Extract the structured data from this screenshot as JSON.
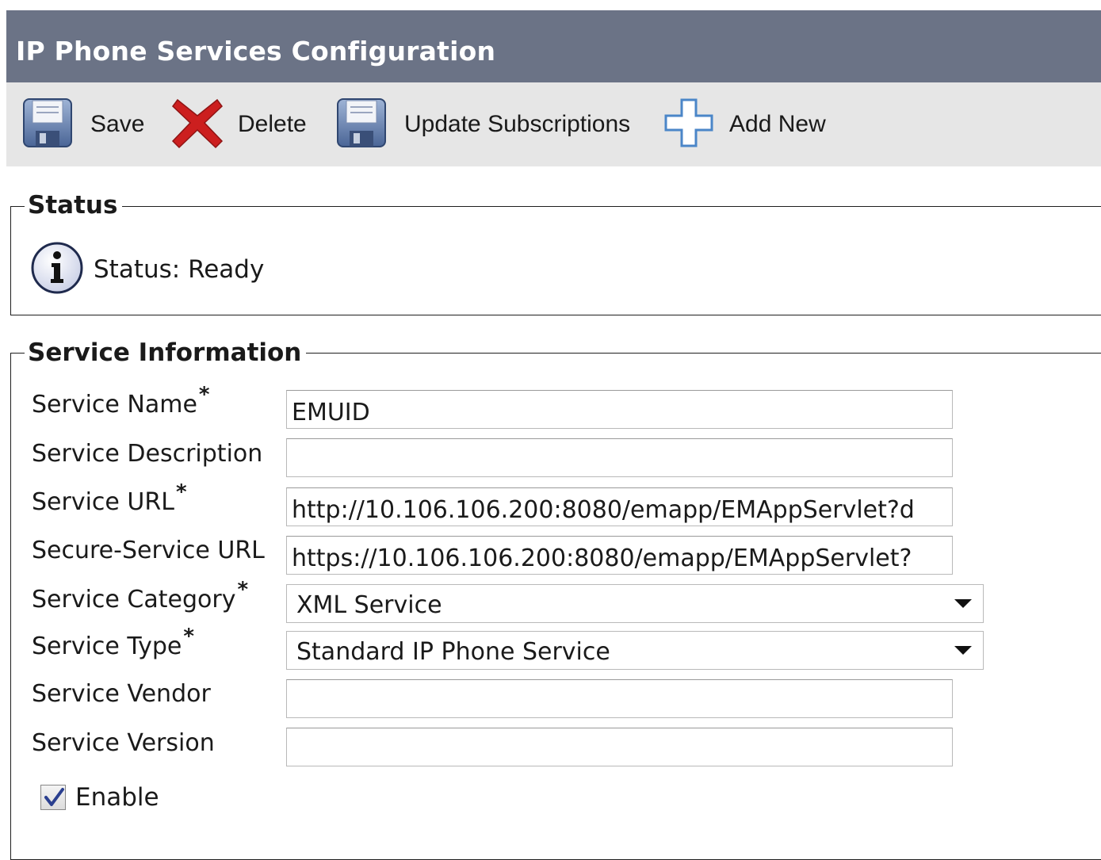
{
  "header": {
    "title": "IP Phone Services Configuration"
  },
  "toolbar": {
    "save_label": "Save",
    "delete_label": "Delete",
    "update_label": "Update Subscriptions",
    "addnew_label": "Add New"
  },
  "status": {
    "legend": "Status",
    "text": "Status: Ready",
    "icon": "info-icon"
  },
  "service": {
    "legend": "Service Information",
    "required_marker": "*",
    "name_label": "Service Name",
    "name_value": "EMUID",
    "description_label": "Service Description",
    "description_value": "",
    "url_label": "Service URL",
    "url_value": "http://10.106.106.200:8080/emapp/EMAppServlet?d",
    "secure_url_label": "Secure-Service URL",
    "secure_url_value": "https://10.106.106.200:8080/emapp/EMAppServlet?",
    "category_label": "Service Category",
    "category_value": "XML Service",
    "type_label": "Service Type",
    "type_value": "Standard IP Phone Service",
    "vendor_label": "Service Vendor",
    "vendor_value": "",
    "version_label": "Service Version",
    "version_value": "",
    "enable_label": "Enable",
    "enable_checked": true
  },
  "colors": {
    "header_bg": "#6b7386",
    "toolbar_bg": "#e6e6e6",
    "delete_red": "#cc1f1f",
    "add_blue": "#4b86c8"
  }
}
